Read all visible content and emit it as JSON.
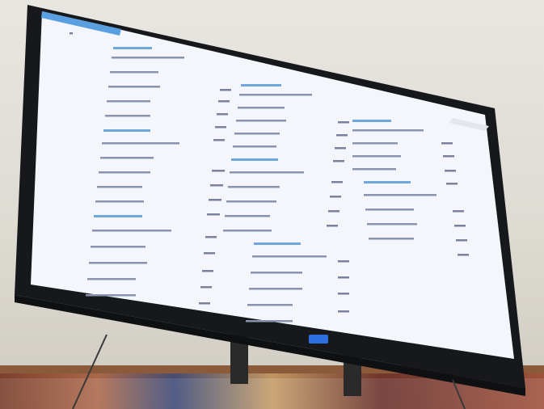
{
  "scene": {
    "description_free": true
  },
  "screen": {
    "header_text": "",
    "columns": [
      {
        "heading_1": "",
        "rows_1": [
          "",
          "",
          "",
          "",
          ""
        ],
        "heading_2": "",
        "rows_2": [
          "",
          "",
          "",
          ""
        ],
        "heading_3": "",
        "rows_3": [
          "",
          "",
          "",
          ""
        ]
      }
    ],
    "values_col_b": [
      "",
      "",
      "",
      "",
      "",
      "",
      "",
      ""
    ],
    "values_col_c": [
      "",
      "",
      "",
      "",
      "",
      "",
      ""
    ]
  },
  "colors": {
    "screen_bg": "#f4f6fb",
    "screen_top_bar": "#5aa0e0",
    "heading_blue": "#5b9bd5",
    "text_grey": "#7a83a0",
    "tv_bezel": "#16181c",
    "wall": "#e3e1da",
    "indicator_blue": "#2b6fe0"
  }
}
